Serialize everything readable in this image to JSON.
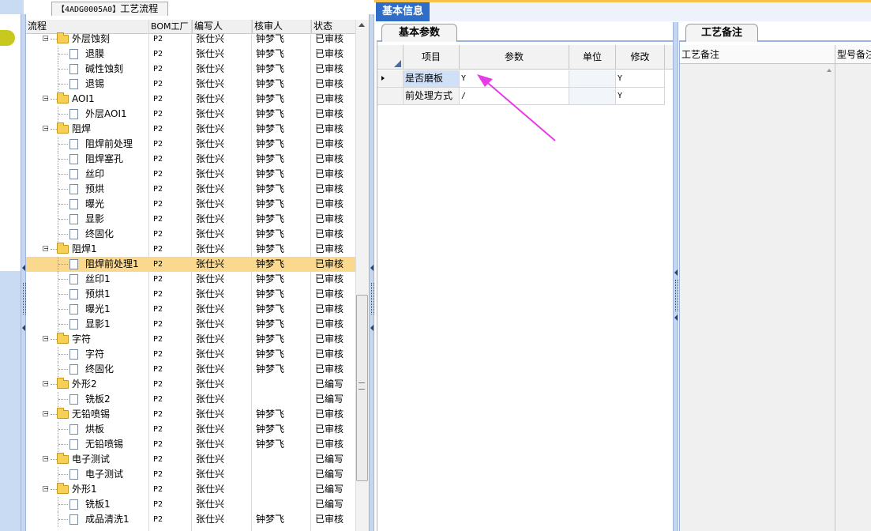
{
  "tree": {
    "tab_code": "【4ADG0005A0】",
    "tab_label": "工艺流程",
    "columns": [
      "流程",
      "BOM工厂",
      "编写人",
      "核审人",
      "状态"
    ],
    "rows": [
      {
        "name": "外层蚀刻",
        "level": 0,
        "type": "folder",
        "factory": "P2",
        "writer": "张仕兴",
        "reviewer": "钟梦飞",
        "status": "已审核"
      },
      {
        "name": "退膜",
        "level": 1,
        "type": "doc",
        "factory": "P2",
        "writer": "张仕兴",
        "reviewer": "钟梦飞",
        "status": "已审核"
      },
      {
        "name": "碱性蚀刻",
        "level": 1,
        "type": "doc",
        "factory": "P2",
        "writer": "张仕兴",
        "reviewer": "钟梦飞",
        "status": "已审核"
      },
      {
        "name": "退锡",
        "level": 1,
        "type": "doc",
        "factory": "P2",
        "writer": "张仕兴",
        "reviewer": "钟梦飞",
        "status": "已审核"
      },
      {
        "name": "AOI1",
        "level": 0,
        "type": "folder",
        "factory": "P2",
        "writer": "张仕兴",
        "reviewer": "钟梦飞",
        "status": "已审核"
      },
      {
        "name": "外层AOI1",
        "level": 1,
        "type": "doc",
        "factory": "P2",
        "writer": "张仕兴",
        "reviewer": "钟梦飞",
        "status": "已审核"
      },
      {
        "name": "阻焊",
        "level": 0,
        "type": "folder",
        "factory": "P2",
        "writer": "张仕兴",
        "reviewer": "钟梦飞",
        "status": "已审核"
      },
      {
        "name": "阻焊前处理",
        "level": 1,
        "type": "doc",
        "factory": "P2",
        "writer": "张仕兴",
        "reviewer": "钟梦飞",
        "status": "已审核"
      },
      {
        "name": "阻焊塞孔",
        "level": 1,
        "type": "doc",
        "factory": "P2",
        "writer": "张仕兴",
        "reviewer": "钟梦飞",
        "status": "已审核"
      },
      {
        "name": "丝印",
        "level": 1,
        "type": "doc",
        "factory": "P2",
        "writer": "张仕兴",
        "reviewer": "钟梦飞",
        "status": "已审核"
      },
      {
        "name": "预烘",
        "level": 1,
        "type": "doc",
        "factory": "P2",
        "writer": "张仕兴",
        "reviewer": "钟梦飞",
        "status": "已审核"
      },
      {
        "name": "曝光",
        "level": 1,
        "type": "doc",
        "factory": "P2",
        "writer": "张仕兴",
        "reviewer": "钟梦飞",
        "status": "已审核"
      },
      {
        "name": "显影",
        "level": 1,
        "type": "doc",
        "factory": "P2",
        "writer": "张仕兴",
        "reviewer": "钟梦飞",
        "status": "已审核"
      },
      {
        "name": "终固化",
        "level": 1,
        "type": "doc",
        "factory": "P2",
        "writer": "张仕兴",
        "reviewer": "钟梦飞",
        "status": "已审核"
      },
      {
        "name": "阻焊1",
        "level": 0,
        "type": "folder",
        "factory": "P2",
        "writer": "张仕兴",
        "reviewer": "钟梦飞",
        "status": "已审核"
      },
      {
        "name": "阻焊前处理1",
        "level": 1,
        "type": "doc",
        "factory": "P2",
        "writer": "张仕兴",
        "reviewer": "钟梦飞",
        "status": "已审核",
        "selected": true
      },
      {
        "name": "丝印1",
        "level": 1,
        "type": "doc",
        "factory": "P2",
        "writer": "张仕兴",
        "reviewer": "钟梦飞",
        "status": "已审核"
      },
      {
        "name": "预烘1",
        "level": 1,
        "type": "doc",
        "factory": "P2",
        "writer": "张仕兴",
        "reviewer": "钟梦飞",
        "status": "已审核"
      },
      {
        "name": "曝光1",
        "level": 1,
        "type": "doc",
        "factory": "P2",
        "writer": "张仕兴",
        "reviewer": "钟梦飞",
        "status": "已审核"
      },
      {
        "name": "显影1",
        "level": 1,
        "type": "doc",
        "factory": "P2",
        "writer": "张仕兴",
        "reviewer": "钟梦飞",
        "status": "已审核"
      },
      {
        "name": "字符",
        "level": 0,
        "type": "folder",
        "factory": "P2",
        "writer": "张仕兴",
        "reviewer": "钟梦飞",
        "status": "已审核"
      },
      {
        "name": "字符",
        "level": 1,
        "type": "doc",
        "factory": "P2",
        "writer": "张仕兴",
        "reviewer": "钟梦飞",
        "status": "已审核"
      },
      {
        "name": "终固化",
        "level": 1,
        "type": "doc",
        "factory": "P2",
        "writer": "张仕兴",
        "reviewer": "钟梦飞",
        "status": "已审核"
      },
      {
        "name": "外形2",
        "level": 0,
        "type": "folder",
        "factory": "P2",
        "writer": "张仕兴",
        "reviewer": "",
        "status": "已编写"
      },
      {
        "name": "铣板2",
        "level": 1,
        "type": "doc",
        "factory": "P2",
        "writer": "张仕兴",
        "reviewer": "",
        "status": "已编写"
      },
      {
        "name": "无铅喷锡",
        "level": 0,
        "type": "folder",
        "factory": "P2",
        "writer": "张仕兴",
        "reviewer": "钟梦飞",
        "status": "已审核"
      },
      {
        "name": "烘板",
        "level": 1,
        "type": "doc",
        "factory": "P2",
        "writer": "张仕兴",
        "reviewer": "钟梦飞",
        "status": "已审核"
      },
      {
        "name": "无铅喷锡",
        "level": 1,
        "type": "doc",
        "factory": "P2",
        "writer": "张仕兴",
        "reviewer": "钟梦飞",
        "status": "已审核"
      },
      {
        "name": "电子测试",
        "level": 0,
        "type": "folder",
        "factory": "P2",
        "writer": "张仕兴",
        "reviewer": "",
        "status": "已编写"
      },
      {
        "name": "电子测试",
        "level": 1,
        "type": "doc",
        "factory": "P2",
        "writer": "张仕兴",
        "reviewer": "",
        "status": "已编写"
      },
      {
        "name": "外形1",
        "level": 0,
        "type": "folder",
        "factory": "P2",
        "writer": "张仕兴",
        "reviewer": "",
        "status": "已编写"
      },
      {
        "name": "铣板1",
        "level": 1,
        "type": "doc",
        "factory": "P2",
        "writer": "张仕兴",
        "reviewer": "",
        "status": "已编写"
      },
      {
        "name": "成品清洗1",
        "level": 1,
        "type": "doc",
        "factory": "P2",
        "writer": "张仕兴",
        "reviewer": "钟梦飞",
        "status": "已审核"
      }
    ],
    "selected_color": "#fad98f"
  },
  "right": {
    "main_tab": "基本信息",
    "params_tab": "基本参数",
    "notes_tab": "工艺备注",
    "grid_columns": [
      "项目",
      "参数",
      "单位",
      "修改"
    ],
    "grid_rows": [
      {
        "item": "是否磨板",
        "param": "Y",
        "unit": "",
        "modify": "Y",
        "current": true
      },
      {
        "item": "前处理方式",
        "param": "/",
        "unit": "",
        "modify": "Y",
        "current": false
      }
    ],
    "notes_columns": [
      "工艺备注",
      "型号备注"
    ]
  },
  "colors": {
    "accent_blue": "#2e6ec8",
    "top_bar": "#f7c24a",
    "annotation_arrow": "#e63be6"
  }
}
